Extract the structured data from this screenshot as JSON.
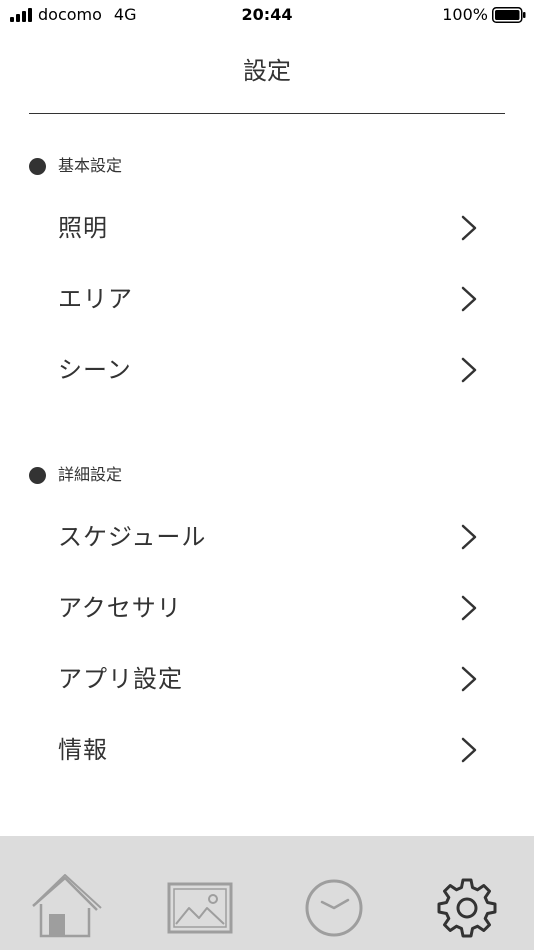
{
  "status_bar": {
    "carrier": "docomo",
    "network": "4G",
    "time": "20:44",
    "battery": "100%"
  },
  "header": {
    "title": "設定"
  },
  "sections": [
    {
      "title": "基本設定",
      "items": [
        {
          "label": "照明"
        },
        {
          "label": "エリア"
        },
        {
          "label": "シーン"
        }
      ]
    },
    {
      "title": "詳細設定",
      "items": [
        {
          "label": "スケジュール"
        },
        {
          "label": "アクセサリ"
        },
        {
          "label": "アプリ設定"
        },
        {
          "label": "情報"
        }
      ]
    }
  ],
  "tab_bar": {
    "tabs": [
      {
        "icon": "home-icon",
        "active": false
      },
      {
        "icon": "picture-icon",
        "active": false
      },
      {
        "icon": "clock-icon",
        "active": false
      },
      {
        "icon": "gear-icon",
        "active": true
      }
    ]
  },
  "colors": {
    "text": "#333333",
    "tab_bar_bg": "#dcdcdc",
    "tab_icon_inactive": "#9e9e9e",
    "tab_icon_active": "#333333"
  }
}
